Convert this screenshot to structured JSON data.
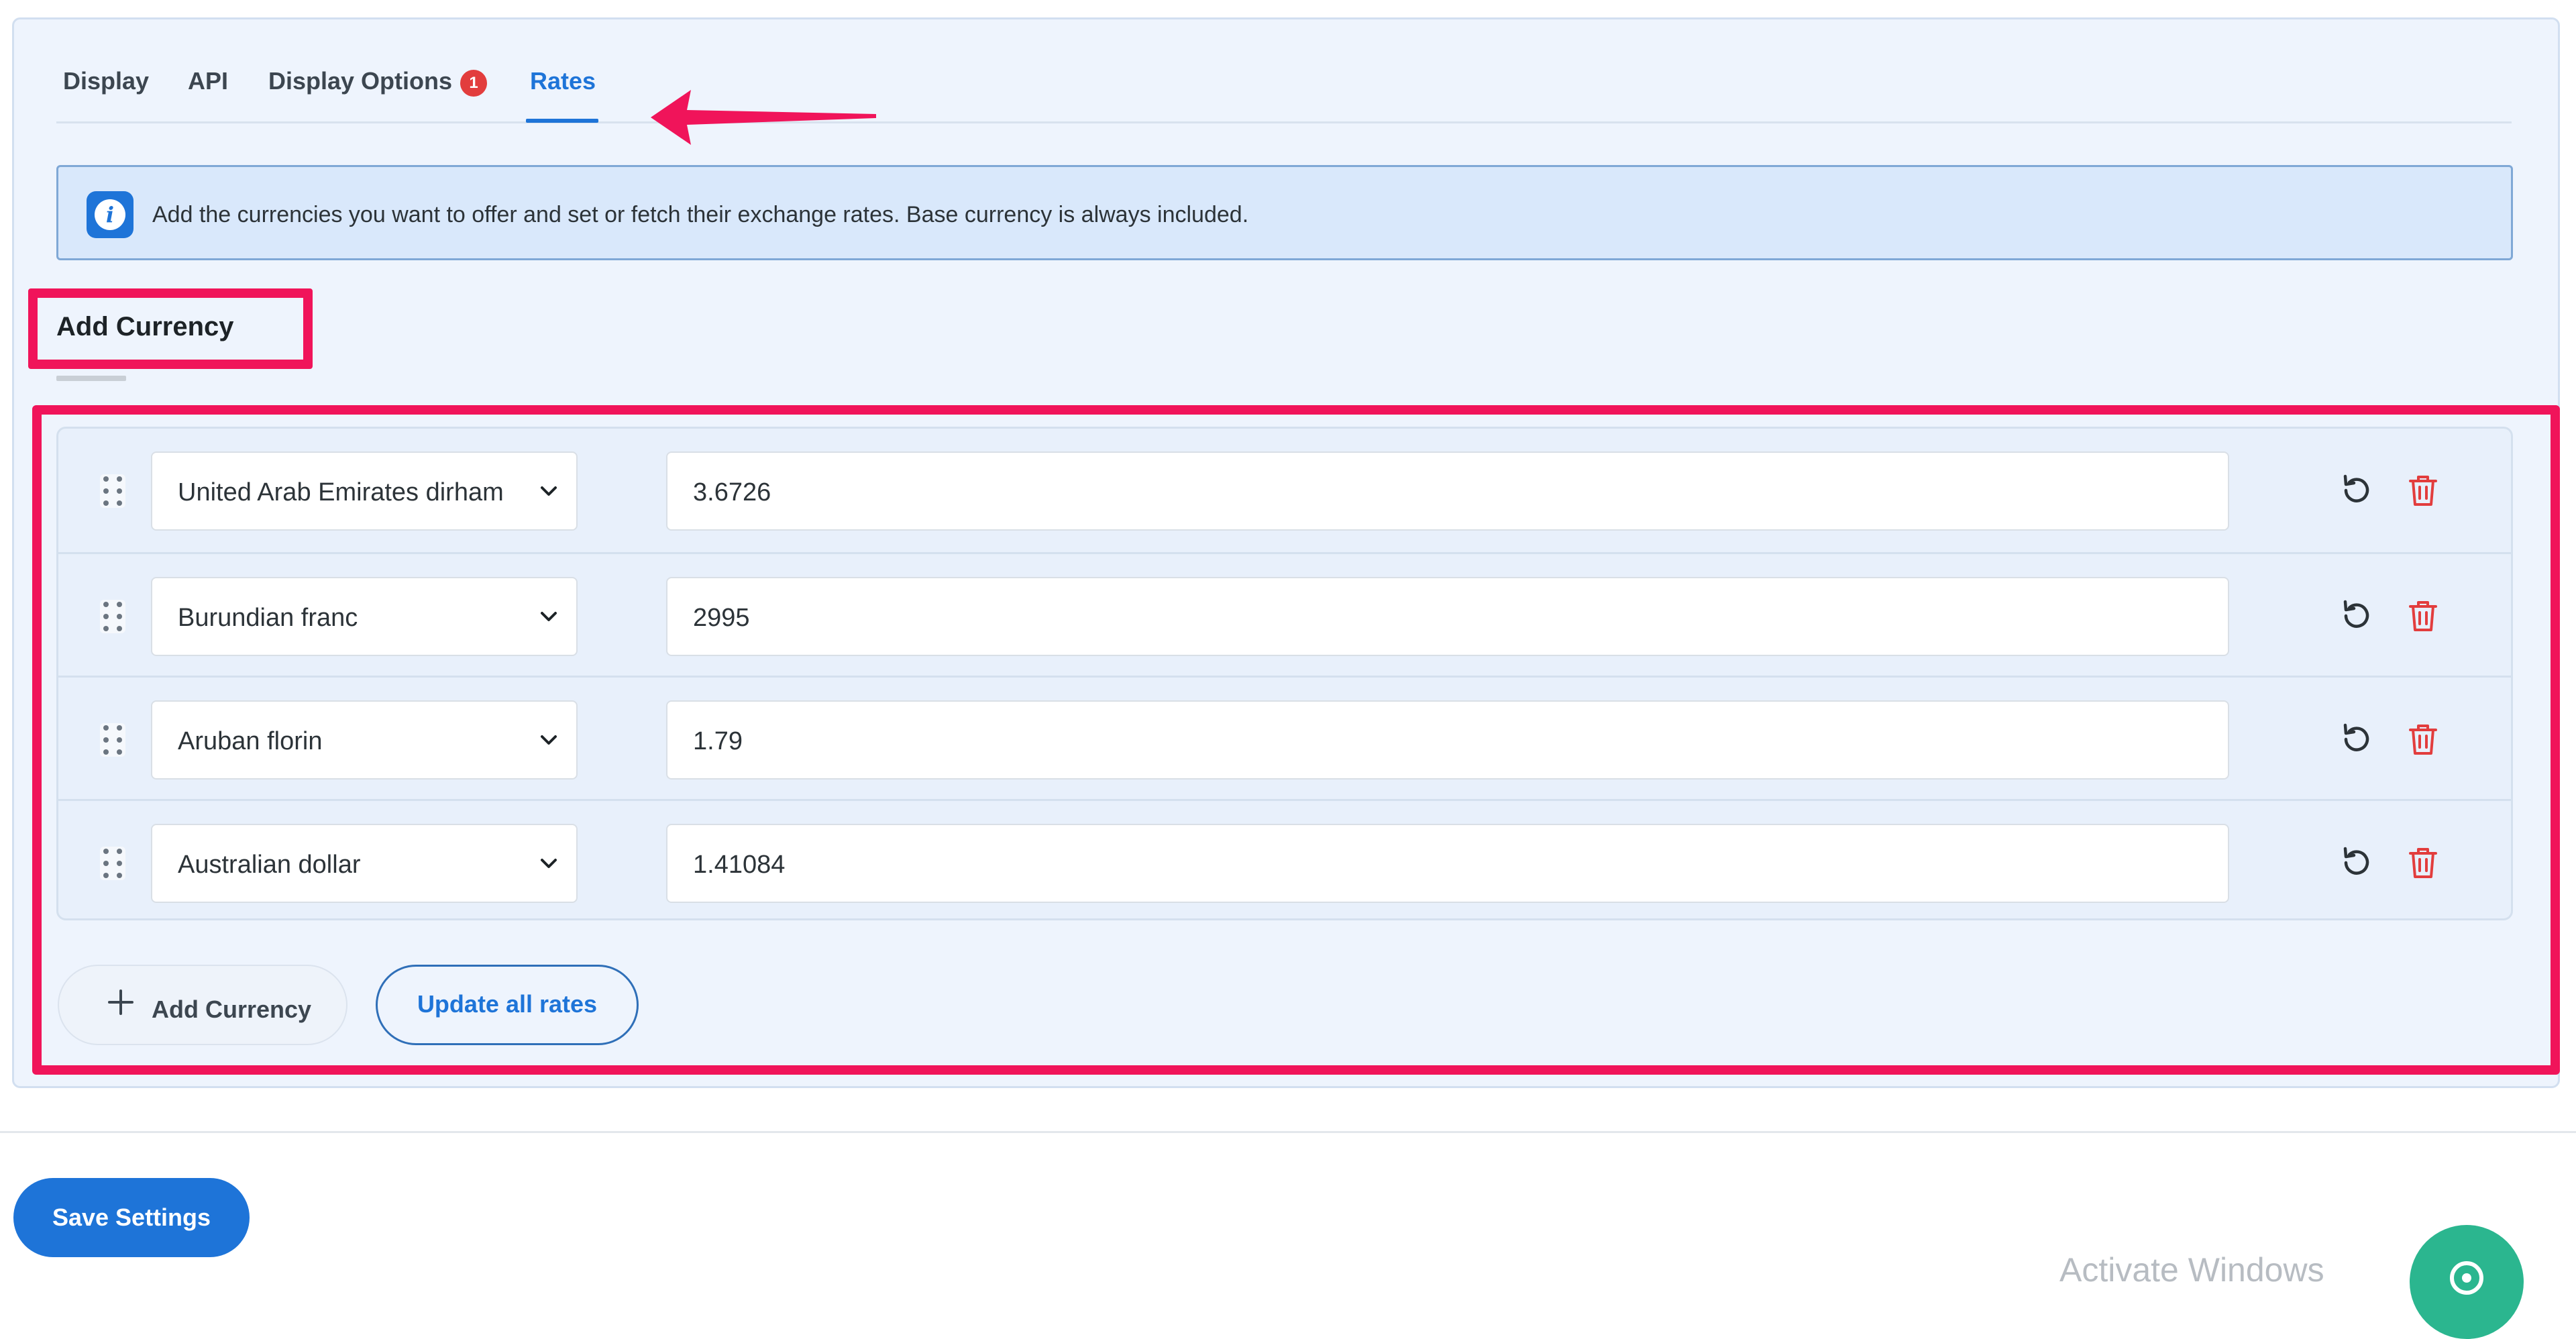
{
  "tabs": [
    {
      "label": "Display"
    },
    {
      "label": "API"
    },
    {
      "label": "Display Options",
      "badge": "1"
    },
    {
      "label": "Rates",
      "active": true
    }
  ],
  "notice": {
    "text": "Add the currencies you want to offer and set or fetch their exchange rates. Base currency is always included."
  },
  "section": {
    "title": "Add Currency"
  },
  "currencies": [
    {
      "name": "United Arab Emirates dirham",
      "rate": "3.6726"
    },
    {
      "name": "Burundian franc",
      "rate": "2995"
    },
    {
      "name": "Aruban florin",
      "rate": "1.79"
    },
    {
      "name": "Australian dollar",
      "rate": "1.41084"
    }
  ],
  "buttons": {
    "add_currency": "Add Currency",
    "update_all_rates": "Update all rates",
    "save_settings": "Save Settings"
  },
  "watermark": "Activate Windows",
  "colors": {
    "accent": "#1e74d8",
    "highlight": "#f0145a",
    "delete": "#e23d3d",
    "help": "#2bb68f"
  }
}
